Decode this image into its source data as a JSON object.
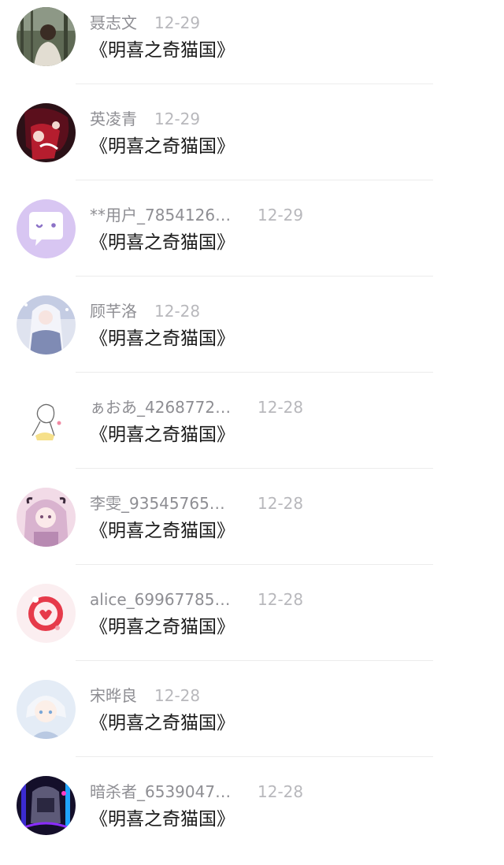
{
  "comments": [
    {
      "user": "聂志文",
      "date": "12-29",
      "content": "《明喜之奇猫国》",
      "avatar": "photo-avatar-forest-girl"
    },
    {
      "user": "英凌青",
      "date": "12-29",
      "content": "《明喜之奇猫国》",
      "avatar": "anime-avatar-red-dark"
    },
    {
      "user": "**用户_7854126…",
      "date": "12-29",
      "content": "《明喜之奇猫国》",
      "avatar": "chat-bubble-avatar"
    },
    {
      "user": "顾芊洛",
      "date": "12-28",
      "content": "《明喜之奇猫国》",
      "avatar": "anime-avatar-winter-girl"
    },
    {
      "user": "ぁおあ_4268772…",
      "date": "12-28",
      "content": "《明喜之奇猫国》",
      "avatar": "sketch-avatar-girl"
    },
    {
      "user": "李雯_93545765…",
      "date": "12-28",
      "content": "《明喜之奇猫国》",
      "avatar": "anime-avatar-pink-girl"
    },
    {
      "user": "alice_69967785…",
      "date": "12-28",
      "content": "《明喜之奇猫国》",
      "avatar": "pomegranate-avatar"
    },
    {
      "user": "宋晔良",
      "date": "12-28",
      "content": "《明喜之奇猫国》",
      "avatar": "anime-avatar-white-hair-boy"
    },
    {
      "user": "暗杀者_6539047…",
      "date": "12-28",
      "content": "《明喜之奇猫国》",
      "avatar": "neon-avatar-dark"
    }
  ],
  "colors": {
    "name_text": "#8e8e93",
    "date_text": "#b8b8bc",
    "content_text": "#1a1a1a",
    "divider": "#ececec"
  }
}
